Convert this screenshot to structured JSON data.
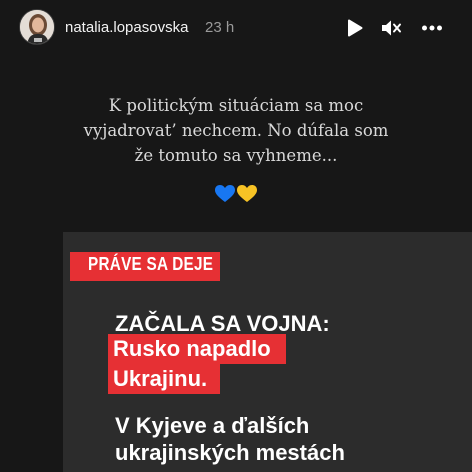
{
  "header": {
    "username": "natalia.lopasovska",
    "time": "23 h"
  },
  "icons": {
    "play": "play-icon",
    "mute": "mute-icon",
    "more": "more-icon"
  },
  "caption": {
    "lines": [
      "K politickým situáciam sa moc",
      "vyjadrovat’ nechcem. No dúfala som",
      "že tomuto sa vyhneme..."
    ],
    "emoji": "💙💛"
  },
  "news": {
    "banner": "PRÁVE SA DEJE",
    "headline": "ZAČALA SA VOJNA:",
    "highlight_1": "Rusko napadlo",
    "highlight_2": "Ukrajinu.",
    "body_1": "V Kyjeve a ďalších",
    "body_2": "ukrajinských mestách"
  },
  "colors": {
    "background": "#171717",
    "panel": "#2c2c2c",
    "accent_red": "#e63034",
    "heart_blue": "#1877f2",
    "heart_yellow": "#f7c325"
  }
}
